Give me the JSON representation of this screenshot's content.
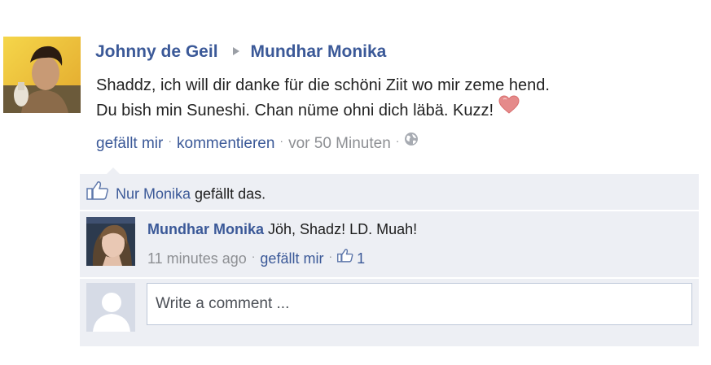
{
  "post": {
    "author": "Johnny de Geil",
    "recipient": "Mundhar Monika",
    "line1": "Shaddz, ich will dir danke für die schöni Ziit wo mir zeme hend.",
    "line2": "Du bish min Suneshi. Chan nüme ohni dich läbä. Kuzz!",
    "like_label": "gefällt mir",
    "comment_label": "kommentieren",
    "timestamp": "vor 50 Minuten",
    "author_avatar_icon": "user-photo",
    "heart_icon": "heart-icon",
    "globe_icon": "globe-icon"
  },
  "likes": {
    "name": "Nur Monika",
    "suffix": " gefällt das.",
    "icon": "thumbs-up-icon"
  },
  "comment": {
    "author": "Mundhar Monika",
    "text": " Jöh, Shadz! LD. Muah!",
    "time": "11 minutes ago",
    "like_label": "gefällt mir",
    "like_count": "1"
  },
  "composer": {
    "placeholder": "Write a comment ..."
  },
  "colors": {
    "link": "#3b5998",
    "muted": "#8d8f93",
    "panel": "#edeff4",
    "heart": "#e07c7c"
  }
}
